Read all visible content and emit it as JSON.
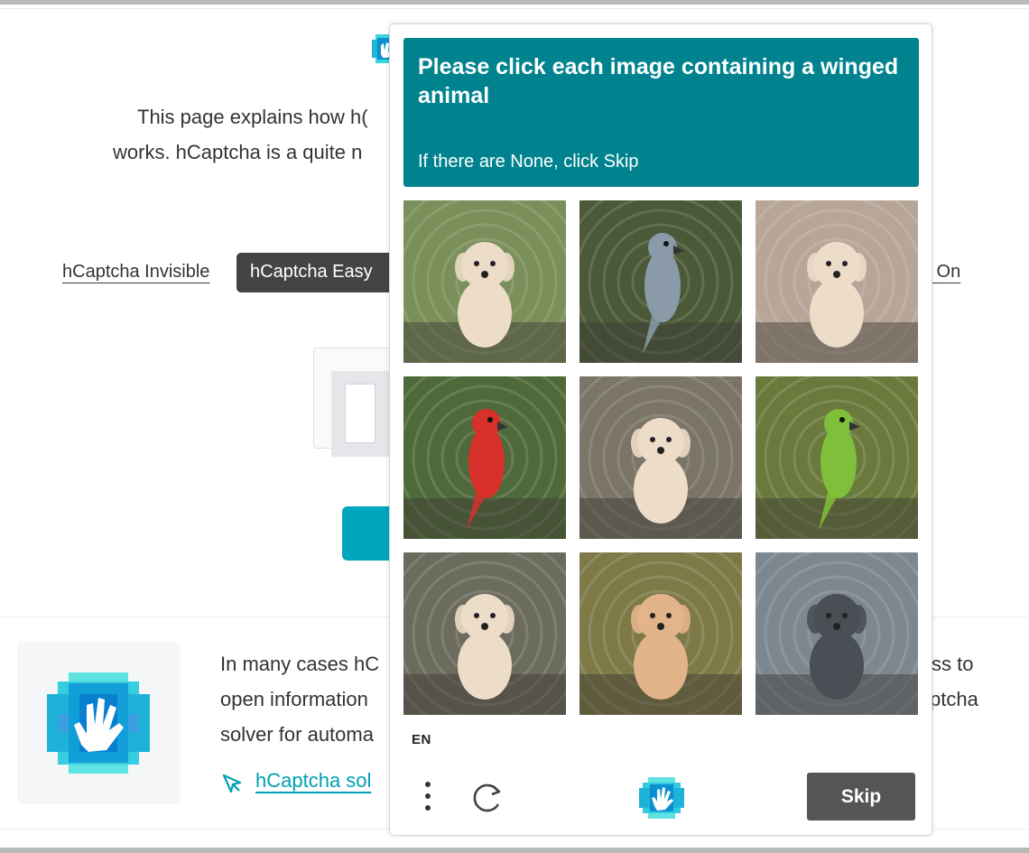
{
  "page": {
    "intro_line1": "This page explains how h(",
    "intro_line2": "works. hCaptcha is a quite n",
    "tabs": {
      "invisible": "hCaptcha Invisible",
      "easy": "hCaptcha Easy",
      "always_on_fragment": "ys On"
    },
    "info_line1": "In many cases hC",
    "info_line2": "open information",
    "info_line3": "solver for automa",
    "info_right1": "ss to",
    "info_right2": "ptcha",
    "solver_link": "hCaptcha sol"
  },
  "captcha": {
    "prompt_title": "Please click each image containing a winged animal",
    "prompt_subtitle": "If there are None, click Skip",
    "language": "EN",
    "skip_label": "Skip",
    "colors": {
      "prompt_bg": "#00838f",
      "skip_bg": "#555555",
      "accent": "#00a6bd"
    },
    "tiles": [
      {
        "subject": "dog",
        "bg": "#7a8f5a"
      },
      {
        "subject": "parrot",
        "bg": "#4a5a38"
      },
      {
        "subject": "dog",
        "bg": "#b7a698"
      },
      {
        "subject": "parrot",
        "bg": "#4f6a3a"
      },
      {
        "subject": "dog",
        "bg": "#7a7566"
      },
      {
        "subject": "parrot",
        "bg": "#6a7a3c"
      },
      {
        "subject": "dog",
        "bg": "#6b6b5e"
      },
      {
        "subject": "dog",
        "bg": "#7d7a48"
      },
      {
        "subject": "dog",
        "bg": "#7c8790"
      }
    ]
  },
  "icons": {
    "menu": "vertical-dots-icon",
    "refresh": "refresh-icon",
    "logo": "hcaptcha-logo-icon",
    "solver": "pointer-icon"
  }
}
